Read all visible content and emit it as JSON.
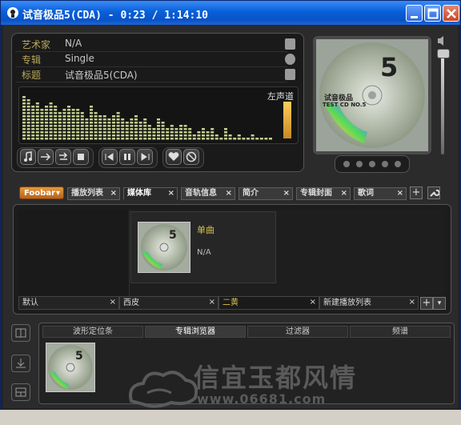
{
  "window": {
    "title": "试音极品5(CDA) - 0:23 / 1:14:10"
  },
  "now_playing": {
    "labels": {
      "artist": "艺术家",
      "album": "专辑",
      "title": "标题"
    },
    "values": {
      "artist": "N/A",
      "album": "Single",
      "title": "试音极品5(CDA)"
    },
    "channel_label": "左声道"
  },
  "cover": {
    "disc_title": "试音极品",
    "disc_subtitle": "TEST CD NO.5",
    "disc_number": "5"
  },
  "main_tabs": {
    "menu_label": "Foobar",
    "tabs": [
      "播放列表",
      "媒体库",
      "音轨信息",
      "简介",
      "专辑封面",
      "歌词"
    ],
    "active": 1
  },
  "library": {
    "album_title": "单曲",
    "album_artist": "N/A",
    "playlist_tabs": [
      "默认",
      "西皮",
      "二黄",
      "新建播放列表"
    ],
    "active_playlist": 2
  },
  "bottom_tabs": {
    "tabs": [
      "波形定位条",
      "专辑浏览器",
      "过滤器",
      "频谱"
    ],
    "active": 1
  },
  "watermark": {
    "text": "信宜玉都风情",
    "url": "www.06681.com"
  },
  "colors": {
    "title_bar": "#0a5fd8",
    "accent_gold": "#d8c24a",
    "label_gold": "#b8a85a",
    "spectrum": "#c2cf8e"
  }
}
